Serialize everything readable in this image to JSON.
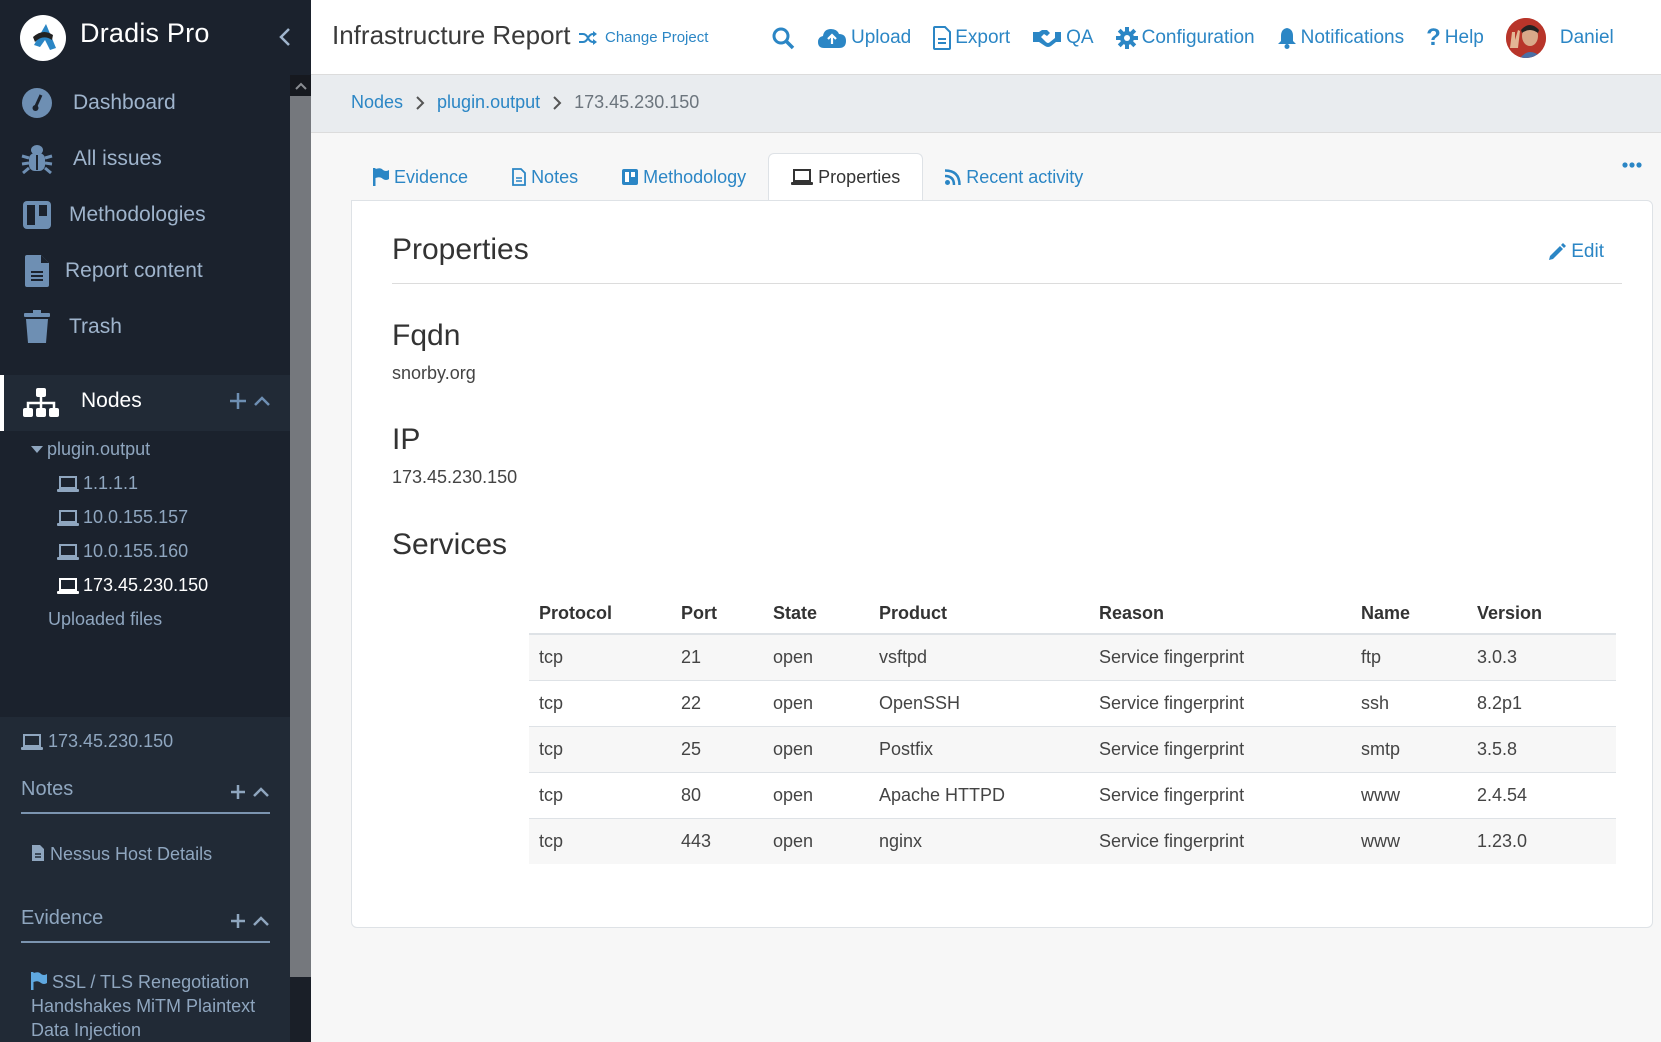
{
  "app": {
    "name": "Dradis Pro",
    "project_title": "Infrastructure Report",
    "change_project_label": "Change Project"
  },
  "colors": {
    "accent": "#2b86c5",
    "sidebar_bg": "#1b222d",
    "sidebar_panel_bg": "#212a36",
    "sidebar_text": "#9fb4cc"
  },
  "topnav": {
    "search_icon": "search-icon",
    "items": [
      {
        "label": "Upload",
        "icon": "cloud-upload-icon"
      },
      {
        "label": "Export",
        "icon": "file-icon"
      },
      {
        "label": "QA",
        "icon": "handshake-icon"
      },
      {
        "label": "Configuration",
        "icon": "gear-icon"
      },
      {
        "label": "Notifications",
        "icon": "bell-icon"
      },
      {
        "label": "Help",
        "icon": "question-icon"
      }
    ],
    "user": {
      "name": "Daniel"
    }
  },
  "sidebar": {
    "nav": [
      {
        "label": "Dashboard",
        "icon": "dashboard-icon"
      },
      {
        "label": "All issues",
        "icon": "bug-icon"
      },
      {
        "label": "Methodologies",
        "icon": "board-icon"
      },
      {
        "label": "Report content",
        "icon": "file-icon"
      },
      {
        "label": "Trash",
        "icon": "trash-icon"
      }
    ],
    "nodes_label": "Nodes",
    "tree": {
      "root": "plugin.output",
      "children": [
        "1.1.1.1",
        "10.0.155.157",
        "10.0.155.160",
        "173.45.230.150"
      ],
      "active": "173.45.230.150",
      "uploaded_files": "Uploaded files"
    },
    "current_node": "173.45.230.150",
    "notes": {
      "title": "Notes",
      "items": [
        "Nessus Host Details"
      ]
    },
    "evidence": {
      "title": "Evidence",
      "items": [
        "SSL / TLS Renegotiation Handshakes MiTM Plaintext Data Injection"
      ]
    }
  },
  "breadcrumb": {
    "items": [
      "Nodes",
      "plugin.output"
    ],
    "current": "173.45.230.150"
  },
  "tabs": [
    {
      "label": "Evidence",
      "icon": "flag-icon",
      "active": false
    },
    {
      "label": "Notes",
      "icon": "file-icon",
      "active": false
    },
    {
      "label": "Methodology",
      "icon": "board-icon",
      "active": false
    },
    {
      "label": "Properties",
      "icon": "laptop-icon",
      "active": true
    },
    {
      "label": "Recent activity",
      "icon": "rss-icon",
      "active": false
    }
  ],
  "properties": {
    "title": "Properties",
    "edit_label": "Edit",
    "fqdn": {
      "label": "Fqdn",
      "value": "snorby.org"
    },
    "ip": {
      "label": "IP",
      "value": "173.45.230.150"
    },
    "services": {
      "label": "Services",
      "columns": [
        "Protocol",
        "Port",
        "State",
        "Product",
        "Reason",
        "Name",
        "Version"
      ],
      "rows": [
        [
          "tcp",
          "21",
          "open",
          "vsftpd",
          "Service fingerprint",
          "ftp",
          "3.0.3"
        ],
        [
          "tcp",
          "22",
          "open",
          "OpenSSH",
          "Service fingerprint",
          "ssh",
          "8.2p1"
        ],
        [
          "tcp",
          "25",
          "open",
          "Postfix",
          "Service fingerprint",
          "smtp",
          "3.5.8"
        ],
        [
          "tcp",
          "80",
          "open",
          "Apache HTTPD",
          "Service fingerprint",
          "www",
          "2.4.54"
        ],
        [
          "tcp",
          "443",
          "open",
          "nginx",
          "Service fingerprint",
          "www",
          "1.23.0"
        ]
      ]
    }
  }
}
